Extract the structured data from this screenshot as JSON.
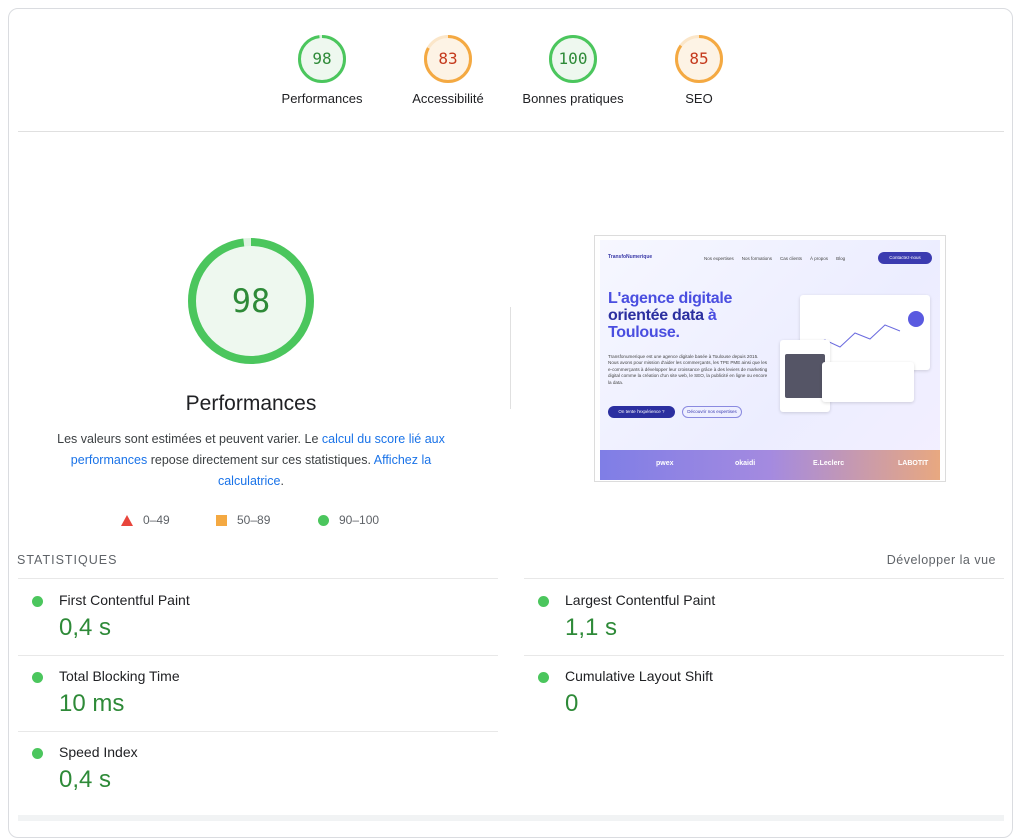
{
  "categories": [
    {
      "score": "98",
      "label": "Performances",
      "fraction": 0.98,
      "status": "good"
    },
    {
      "score": "83",
      "label": "Accessibilité",
      "fraction": 0.83,
      "status": "average"
    },
    {
      "score": "100",
      "label": "Bonnes pratiques",
      "fraction": 1.0,
      "status": "good"
    },
    {
      "score": "85",
      "label": "SEO",
      "fraction": 0.85,
      "status": "average"
    }
  ],
  "main": {
    "score": "98",
    "fraction": 0.98,
    "title": "Performances",
    "desc_pre": "Les valeurs sont estimées et peuvent varier. Le ",
    "desc_link1": "calcul du score lié aux performances",
    "desc_mid": " repose directement sur ces statistiques. ",
    "desc_link2": "Affichez la calculatrice",
    "desc_post": "."
  },
  "legend": [
    {
      "shape": "triangle",
      "range": "0–49",
      "color": "#e8453c"
    },
    {
      "shape": "square",
      "range": "50–89",
      "color": "#f4a942"
    },
    {
      "shape": "circle",
      "range": "90–100",
      "color": "#4bc65d"
    }
  ],
  "thumbnail": {
    "brand": "TransfoNumerique",
    "nav": [
      "Nos expertises",
      "Nos formations",
      "Cas clients",
      "À propos",
      "Blog"
    ],
    "cta": "Contactez-nous",
    "headline_1": "L'agence digitale",
    "headline_2": "orientée data",
    "headline_3": "à",
    "headline_4": "Toulouse.",
    "paragraph": "Transfonumerique est une agence digitale basée à Toulouse depuis 2015. Nous avons pour mission d'aider les commerçants, les TPE PME ainsi que les e-commerçants à développer leur croissance grâce à des leviers de marketing digital comme la création d'un site web, le SEO, la publicité en ligne ou encore la data.",
    "btn_primary": "On tente l'expérience ?",
    "btn_secondary": "Découvrir nos expertises",
    "logos": [
      "pwex",
      "okaidi",
      "E.Leclerc",
      "LABOTIT"
    ]
  },
  "stats": {
    "heading": "STATISTIQUES",
    "expand": "Développer la vue",
    "metrics": [
      {
        "name": "First Contentful Paint",
        "value": "0,4 s"
      },
      {
        "name": "Largest Contentful Paint",
        "value": "1,1 s"
      },
      {
        "name": "Total Blocking Time",
        "value": "10 ms"
      },
      {
        "name": "Cumulative Layout Shift",
        "value": "0"
      },
      {
        "name": "Speed Index",
        "value": "0,4 s"
      }
    ]
  },
  "colors": {
    "good": "#4bc65d",
    "good_text": "#2e8a38",
    "good_bg": "#eef8ef",
    "average": "#f4a942",
    "average_text": "#c4391c",
    "average_bg": "#fdf3e5",
    "link": "#1a73e8"
  }
}
